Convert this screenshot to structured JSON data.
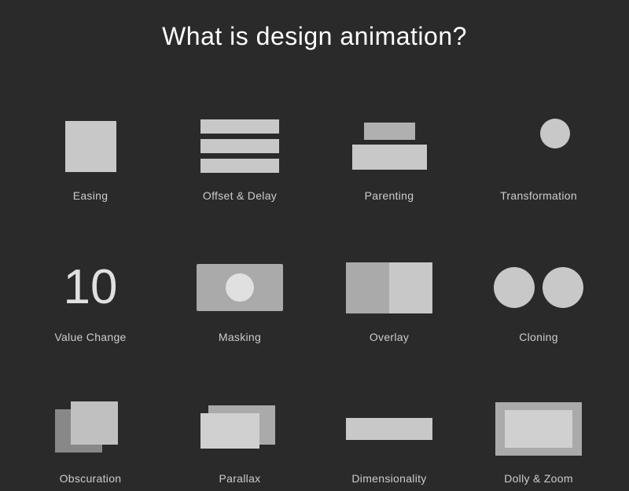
{
  "page": {
    "title": "What is design animation?",
    "cells": [
      {
        "id": "easing",
        "label": "Easing"
      },
      {
        "id": "offset",
        "label": "Offset & Delay"
      },
      {
        "id": "parenting",
        "label": "Parenting"
      },
      {
        "id": "transformation",
        "label": "Transformation"
      },
      {
        "id": "value-change",
        "label": "Value Change"
      },
      {
        "id": "masking",
        "label": "Masking"
      },
      {
        "id": "overlay",
        "label": "Overlay"
      },
      {
        "id": "cloning",
        "label": "Cloning"
      },
      {
        "id": "obscuration",
        "label": "Obscuration"
      },
      {
        "id": "parallax",
        "label": "Parallax"
      },
      {
        "id": "dimensionality",
        "label": "Dimensionality"
      },
      {
        "id": "dolly-zoom",
        "label": "Dolly & Zoom"
      }
    ]
  }
}
